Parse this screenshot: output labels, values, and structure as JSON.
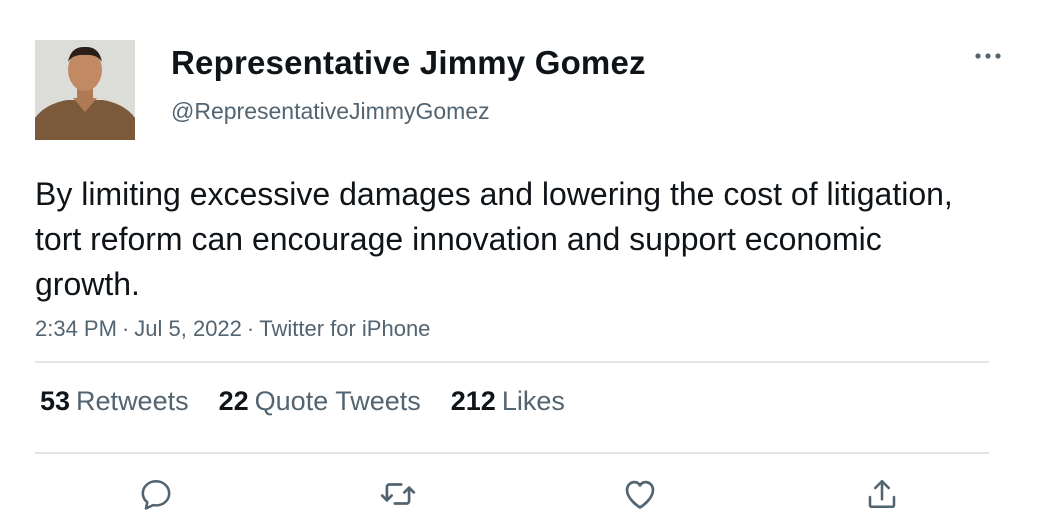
{
  "author": {
    "display_name": "Representative Jimmy Gomez",
    "handle": "@RepresentativeJimmyGomez",
    "avatar_icon": "avatar-photo"
  },
  "tweet": {
    "text": "By limiting excessive damages and lowering the cost of litigation, tort reform can encourage innovation and support economic growth.",
    "time": "2:34 PM",
    "date": "Jul 5, 2022",
    "source": "Twitter for iPhone",
    "separator": "·"
  },
  "stats": {
    "retweets_count": "53",
    "retweets_label": "Retweets",
    "quotes_count": "22",
    "quotes_label": "Quote Tweets",
    "likes_count": "212",
    "likes_label": "Likes"
  },
  "actions": [
    "reply-icon",
    "retweet-icon",
    "like-icon",
    "share-icon"
  ],
  "colors": {
    "text": "#0f1419",
    "secondary": "#536471",
    "divider": "#e1e4e6",
    "icon": "#536471"
  }
}
